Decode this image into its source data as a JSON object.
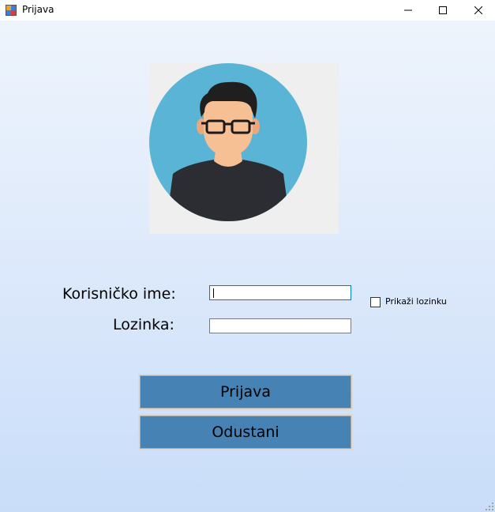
{
  "window": {
    "title": "Prijava"
  },
  "form": {
    "username_label": "Korisničko ime:",
    "username_value": "",
    "password_label": "Lozinka:",
    "password_value": "",
    "show_password_label": "Prikaži lozinku",
    "show_password_checked": false
  },
  "buttons": {
    "login_label": "Prijava",
    "cancel_label": "Odustani"
  },
  "colors": {
    "button_fill": "#4682b4",
    "avatar_background": "#5ab4d6",
    "shirt": "#2b2d33",
    "skin": "#f7bf94",
    "hair": "#1f1f1f"
  },
  "icons": {
    "app": "form-icon",
    "minimize": "minimize-icon",
    "maximize": "maximize-icon",
    "close": "close-icon",
    "avatar": "user-avatar"
  }
}
